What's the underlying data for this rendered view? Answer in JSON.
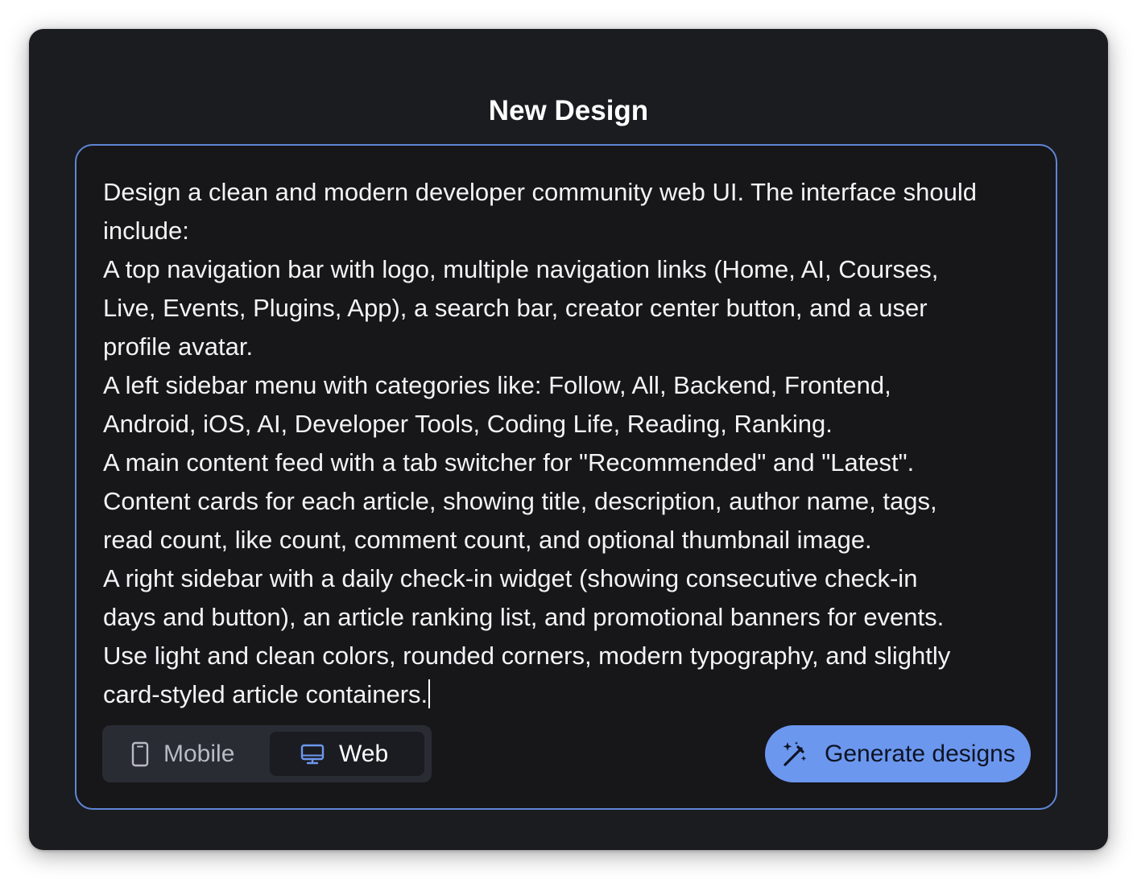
{
  "dialog": {
    "title": "New Design"
  },
  "prompt": {
    "lines": [
      "Design a clean and modern developer community web UI. The interface should",
      "include:",
      "A top navigation bar with logo, multiple navigation links (Home, AI, Courses,",
      "Live, Events, Plugins, App), a search bar, creator center button, and a user",
      "profile avatar.",
      "A left sidebar menu with categories like: Follow, All, Backend, Frontend,",
      "Android, iOS, AI, Developer Tools, Coding Life, Reading, Ranking.",
      "A main content feed with a tab switcher for \"Recommended\" and \"Latest\".",
      "Content cards for each article, showing title, description, author name, tags,",
      "read count, like count, comment count, and optional thumbnail image.",
      "A right sidebar with a daily check-in widget (showing consecutive check-in",
      "days and button), an article ranking list, and promotional banners for events.",
      "Use light and clean colors, rounded corners, modern typography, and slightly",
      "card-styled article containers."
    ]
  },
  "device_toggle": {
    "options": [
      {
        "label": "Mobile",
        "icon": "smartphone-icon",
        "selected": false
      },
      {
        "label": "Web",
        "icon": "monitor-icon",
        "selected": true
      }
    ]
  },
  "generate_button": {
    "label": "Generate designs",
    "icon": "magic-wand-icon"
  },
  "colors": {
    "dialog_bg": "#1b1c20",
    "prompt_border": "#5f86d6",
    "accent": "#6c97ef",
    "toggle_bg": "#2a2c33",
    "selected_segment_bg": "#1b1c21",
    "web_icon": "#6c97ef"
  }
}
